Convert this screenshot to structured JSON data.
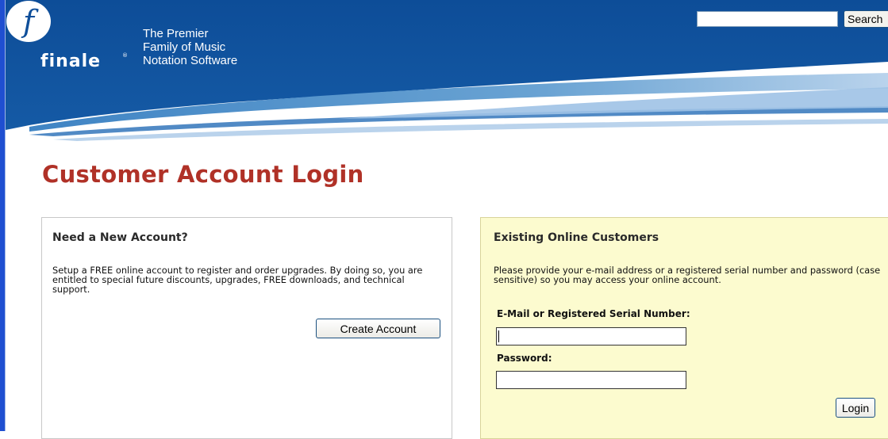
{
  "header": {
    "logo_wordmark": "finale",
    "logo_glyph": "f",
    "logo_registered": "®",
    "tagline_lines": [
      "The Premier",
      "Family of Music",
      "Notation Software"
    ],
    "search": {
      "value": "",
      "button_label": "Search"
    }
  },
  "page": {
    "title": "Customer Account Login"
  },
  "new_account": {
    "heading": "Need a New Account?",
    "description": "Setup a FREE online account to register and order upgrades. By doing so, you are entitled to special future discounts, upgrades, FREE downloads, and technical support.",
    "button_label": "Create Account"
  },
  "existing": {
    "heading": "Existing Online Customers",
    "description": "Please provide your e-mail address or a registered serial number and password (case sensitive) so you may access your online account.",
    "email_label": "E-Mail or Registered Serial Number:",
    "email_value": "",
    "password_label": "Password:",
    "password_value": "",
    "login_label": "Login"
  },
  "colors": {
    "banner_blue": "#0f4f9a",
    "title_red": "#b03127",
    "panel_yellow": "#fcfbcf"
  }
}
